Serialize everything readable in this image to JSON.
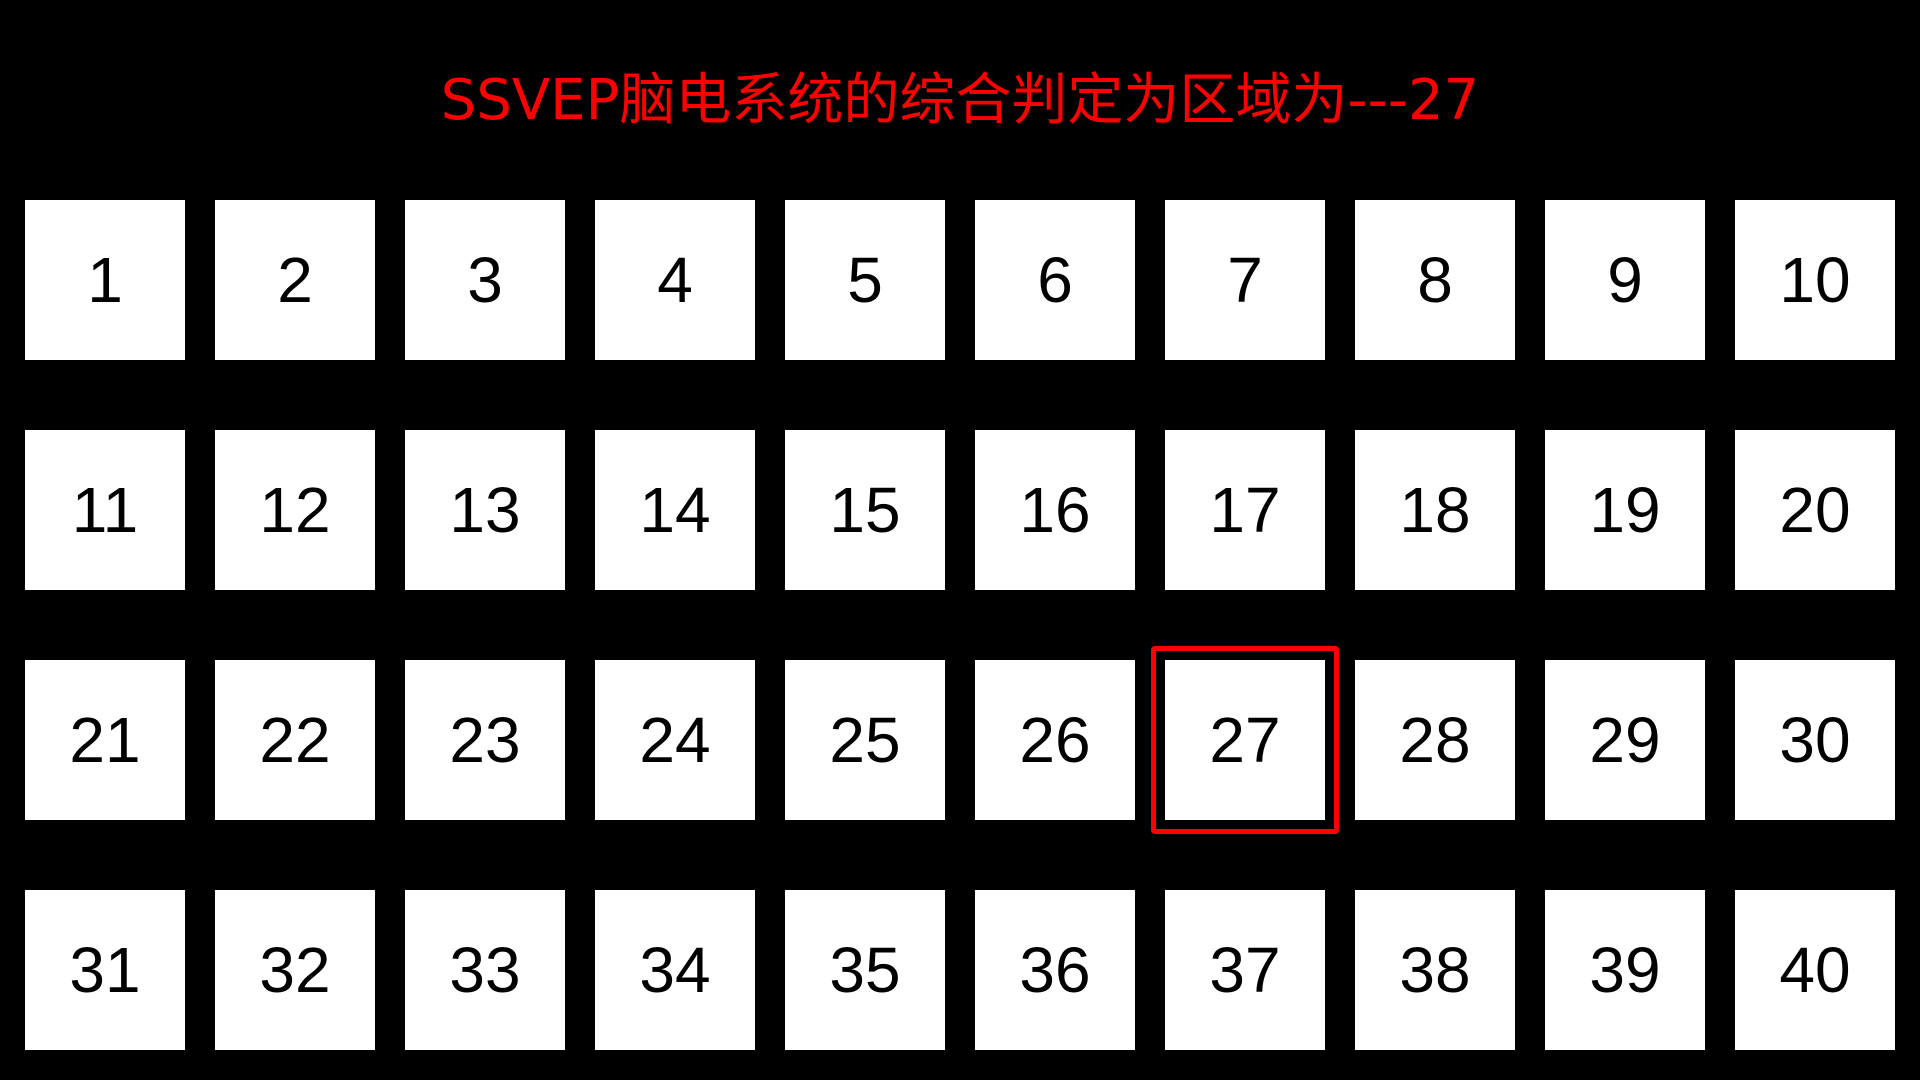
{
  "title": "SSVEP脑电系统的综合判定为区域为---27",
  "selected_target": 27,
  "colors": {
    "background": "#000000",
    "target_fill": "#ffffff",
    "target_text": "#000000",
    "title_text": "#ff0000",
    "selection_border": "#ff0000"
  },
  "targets": [
    "1",
    "2",
    "3",
    "4",
    "5",
    "6",
    "7",
    "8",
    "9",
    "10",
    "11",
    "12",
    "13",
    "14",
    "15",
    "16",
    "17",
    "18",
    "19",
    "20",
    "21",
    "22",
    "23",
    "24",
    "25",
    "26",
    "27",
    "28",
    "29",
    "30",
    "31",
    "32",
    "33",
    "34",
    "35",
    "36",
    "37",
    "38",
    "39",
    "40"
  ]
}
